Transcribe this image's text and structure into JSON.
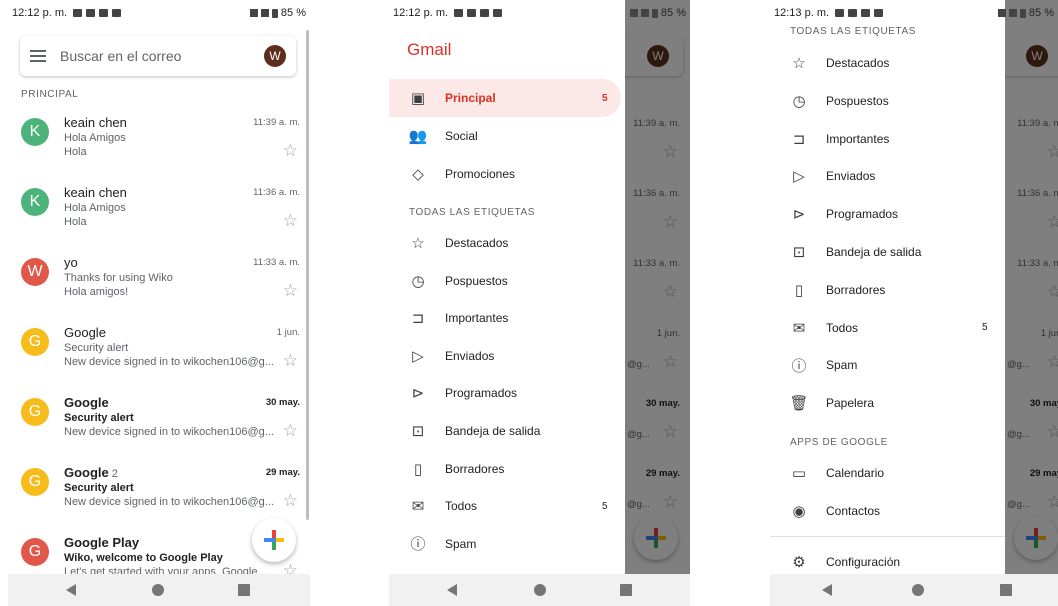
{
  "screen1": {
    "status": {
      "time": "12:12 p. m.",
      "battery": "85 %"
    },
    "search": {
      "placeholder": "Buscar en el correo",
      "avatar": "W"
    },
    "section": "PRINCIPAL",
    "emails": [
      {
        "initial": "K",
        "color": "#4cb47a",
        "from": "keain chen",
        "count": "",
        "date": "11:39 a. m.",
        "subject": "Hola Amigos",
        "snippet": "Hola",
        "unread": false
      },
      {
        "initial": "K",
        "color": "#4cb47a",
        "from": "keain chen",
        "count": "",
        "date": "11:36 a. m.",
        "subject": "Hola Amigos",
        "snippet": "Hola",
        "unread": false
      },
      {
        "initial": "W",
        "color": "#e0584a",
        "from": "yo",
        "count": "",
        "date": "11:33 a. m.",
        "subject": "Thanks for using Wiko",
        "snippet": "Hola amigos!",
        "unread": false
      },
      {
        "initial": "G",
        "color": "#f6bc1c",
        "from": "Google",
        "count": "",
        "date": "1 jun.",
        "subject": "Security alert",
        "snippet": "New device signed in to wikochen106@g...",
        "unread": false
      },
      {
        "initial": "G",
        "color": "#f6bc1c",
        "from": "Google",
        "count": "",
        "date": "30 may.",
        "subject": "Security alert",
        "snippet": "New device signed in to wikochen106@g...",
        "unread": true
      },
      {
        "initial": "G",
        "color": "#f6bc1c",
        "from": "Google",
        "count": "2",
        "date": "29 may.",
        "subject": "Security alert",
        "snippet": "New device signed in to wikochen106@g...",
        "unread": true
      },
      {
        "initial": "G",
        "color": "#e0584a",
        "from": "Google Play",
        "count": "",
        "date": "",
        "subject": "Wiko, welcome to Google Play",
        "snippet": "Let's get started with your apps. Google...",
        "unread": true
      }
    ]
  },
  "screen2": {
    "status": {
      "time": "12:12 p. m.",
      "battery": "85 %"
    },
    "title": "Gmail",
    "items": [
      {
        "icon": "inbox-icon",
        "glyph": "▣",
        "label": "Principal",
        "count": "5",
        "active": true
      },
      {
        "icon": "social-icon",
        "glyph": "👥",
        "label": "Social",
        "count": "",
        "active": false
      },
      {
        "icon": "tag-icon",
        "glyph": "◇",
        "label": "Promociones",
        "count": "",
        "active": false
      }
    ],
    "section_labels": "TODAS LAS ETIQUETAS",
    "labels": [
      {
        "icon": "star-icon",
        "glyph": "☆",
        "label": "Destacados",
        "count": ""
      },
      {
        "icon": "clock-icon",
        "glyph": "◷",
        "label": "Pospuestos",
        "count": ""
      },
      {
        "icon": "important-icon",
        "glyph": "⊐",
        "label": "Importantes",
        "count": ""
      },
      {
        "icon": "send-icon",
        "glyph": "▷",
        "label": "Enviados",
        "count": ""
      },
      {
        "icon": "scheduled-icon",
        "glyph": "⊳",
        "label": "Programados",
        "count": ""
      },
      {
        "icon": "outbox-icon",
        "glyph": "⊡",
        "label": "Bandeja de salida",
        "count": ""
      },
      {
        "icon": "draft-icon",
        "glyph": "▯",
        "label": "Borradores",
        "count": ""
      },
      {
        "icon": "all-mail-icon",
        "glyph": "✉",
        "label": "Todos",
        "count": "5"
      },
      {
        "icon": "spam-icon",
        "glyph": "ⓘ",
        "label": "Spam",
        "count": ""
      }
    ],
    "behind": {
      "avatar": "W",
      "rows": [
        {
          "date": "11:39 a. m.",
          "unread": false,
          "snip": ""
        },
        {
          "date": "11:36 a. m.",
          "unread": false,
          "snip": ""
        },
        {
          "date": "11:33 a. m.",
          "unread": false,
          "snip": ""
        },
        {
          "date": "1 jun.",
          "unread": false,
          "snip": "@g..."
        },
        {
          "date": "30 may.",
          "unread": true,
          "snip": "@g..."
        },
        {
          "date": "29 may.",
          "unread": true,
          "snip": "@g..."
        }
      ]
    }
  },
  "screen3": {
    "status": {
      "time": "12:13 p. m.",
      "battery": "85 %"
    },
    "section_labels": "TODAS LAS ETIQUETAS",
    "labels": [
      {
        "icon": "star-icon",
        "glyph": "☆",
        "label": "Destacados",
        "count": ""
      },
      {
        "icon": "clock-icon",
        "glyph": "◷",
        "label": "Pospuestos",
        "count": ""
      },
      {
        "icon": "important-icon",
        "glyph": "⊐",
        "label": "Importantes",
        "count": ""
      },
      {
        "icon": "send-icon",
        "glyph": "▷",
        "label": "Enviados",
        "count": ""
      },
      {
        "icon": "scheduled-icon",
        "glyph": "⊳",
        "label": "Programados",
        "count": ""
      },
      {
        "icon": "outbox-icon",
        "glyph": "⊡",
        "label": "Bandeja de salida",
        "count": ""
      },
      {
        "icon": "draft-icon",
        "glyph": "▯",
        "label": "Borradores",
        "count": ""
      },
      {
        "icon": "all-mail-icon",
        "glyph": "✉",
        "label": "Todos",
        "count": "5"
      },
      {
        "icon": "spam-icon",
        "glyph": "ⓘ",
        "label": "Spam",
        "count": ""
      },
      {
        "icon": "trash-icon",
        "glyph": "🗑",
        "label": "Papelera",
        "count": ""
      }
    ],
    "section_apps": "APPS DE GOOGLE",
    "apps": [
      {
        "icon": "calendar-icon",
        "glyph": "▭",
        "label": "Calendario"
      },
      {
        "icon": "contacts-icon",
        "glyph": "◉",
        "label": "Contactos"
      }
    ],
    "settings": {
      "icon": "gear-icon",
      "glyph": "⚙",
      "label": "Configuración"
    },
    "behind": {
      "avatar": "W",
      "rows": [
        {
          "date": "11:39 a. m.",
          "unread": false,
          "snip": ""
        },
        {
          "date": "11:36 a. m.",
          "unread": false,
          "snip": ""
        },
        {
          "date": "11:33 a. m.",
          "unread": false,
          "snip": ""
        },
        {
          "date": "1 jun.",
          "unread": false,
          "snip": "@g..."
        },
        {
          "date": "30 may.",
          "unread": true,
          "snip": "@g..."
        },
        {
          "date": "29 may.",
          "unread": true,
          "snip": "@g..."
        }
      ]
    }
  }
}
